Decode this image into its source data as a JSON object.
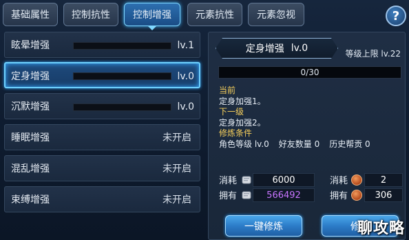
{
  "tabs": [
    {
      "label": "基础属性",
      "active": false
    },
    {
      "label": "控制抗性",
      "active": false
    },
    {
      "label": "控制增强",
      "active": true
    },
    {
      "label": "元素抗性",
      "active": false
    },
    {
      "label": "元素忽视",
      "active": false
    }
  ],
  "help_label": "?",
  "skills": [
    {
      "name": "眩晕增强",
      "level": "lv.1",
      "unlocked": true,
      "selected": false
    },
    {
      "name": "定身增强",
      "level": "lv.0",
      "unlocked": true,
      "selected": true
    },
    {
      "name": "沉默增强",
      "level": "lv.0",
      "unlocked": true,
      "selected": false
    },
    {
      "name": "睡眠增强",
      "status": "未开启",
      "unlocked": false,
      "selected": false
    },
    {
      "name": "混乱增强",
      "status": "未开启",
      "unlocked": false,
      "selected": false
    },
    {
      "name": "束缚增强",
      "status": "未开启",
      "unlocked": false,
      "selected": false
    }
  ],
  "detail": {
    "title": "定身增强",
    "title_level": "lv.0",
    "max_level": "等级上限 lv.22",
    "progress_text": "0/30",
    "current_label": "当前",
    "current_text": "定身加强1。",
    "next_label": "下一级",
    "next_text": "定身加强2。",
    "req_label": "修炼条件",
    "req_role_level": "角色等级 lv.0",
    "req_friends": "好友数量 0",
    "req_contrib": "历史帮贡 0",
    "cost_label_1": "消耗",
    "cost_value_1": "6000",
    "own_label_1": "拥有",
    "own_value_1": "566492",
    "cost_label_2": "消耗",
    "cost_value_2": "2",
    "own_label_2": "拥有",
    "own_value_2": "306",
    "btn_one_key": "一键修炼",
    "btn_train": "修炼"
  },
  "watermark": "聊攻略",
  "colors": {
    "accent": "#6fd2ff",
    "label_gold": "#f6cf5c",
    "own_purple": "#c875ff"
  }
}
